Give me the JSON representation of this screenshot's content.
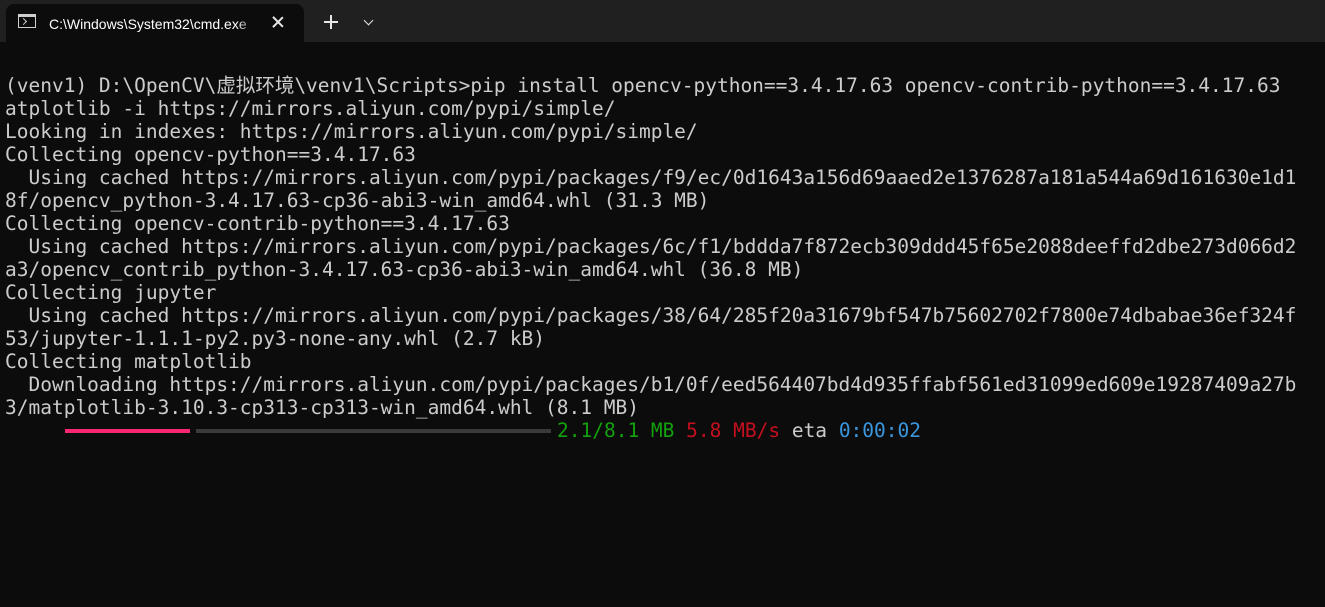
{
  "window": {
    "tab_title": "C:\\Windows\\System32\\cmd.exe"
  },
  "terminal": {
    "lines": [
      "(venv1) D:\\OpenCV\\虚拟环境\\venv1\\Scripts>pip install opencv-python==3.4.17.63 opencv-contrib-python==3.4.17.63",
      "atplotlib -i https://mirrors.aliyun.com/pypi/simple/",
      "Looking in indexes: https://mirrors.aliyun.com/pypi/simple/",
      "Collecting opencv-python==3.4.17.63",
      "  Using cached https://mirrors.aliyun.com/pypi/packages/f9/ec/0d1643a156d69aaed2e1376287a181a544a69d161630e1d1",
      "8f/opencv_python-3.4.17.63-cp36-abi3-win_amd64.whl (31.3 MB)",
      "Collecting opencv-contrib-python==3.4.17.63",
      "  Using cached https://mirrors.aliyun.com/pypi/packages/6c/f1/bddda7f872ecb309ddd45f65e2088deeffd2dbe273d066d2",
      "a3/opencv_contrib_python-3.4.17.63-cp36-abi3-win_amd64.whl (36.8 MB)",
      "Collecting jupyter",
      "  Using cached https://mirrors.aliyun.com/pypi/packages/38/64/285f20a31679bf547b75602702f7800e74dbabae36ef324f",
      "53/jupyter-1.1.1-py2.py3-none-any.whl (2.7 kB)",
      "Collecting matplotlib",
      "  Downloading https://mirrors.aliyun.com/pypi/packages/b1/0f/eed564407bd4d935ffabf561ed31099ed609e19287409a27b",
      "3/matplotlib-3.10.3-cp313-cp313-win_amd64.whl (8.1 MB)"
    ],
    "progress": {
      "fraction": 0.26,
      "size": "2.1/8.1 MB",
      "speed": "5.8 MB/s",
      "eta_label": "eta",
      "eta": "0:00:02"
    }
  },
  "colors": {
    "background": "#0c0c0c",
    "titlebar": "#202020",
    "text": "#cccccc",
    "progress_done": "#f92672",
    "progress_rest": "#3a3a3a",
    "size": "#13a10e",
    "speed": "#c50f1f",
    "eta": "#3a96dd"
  }
}
